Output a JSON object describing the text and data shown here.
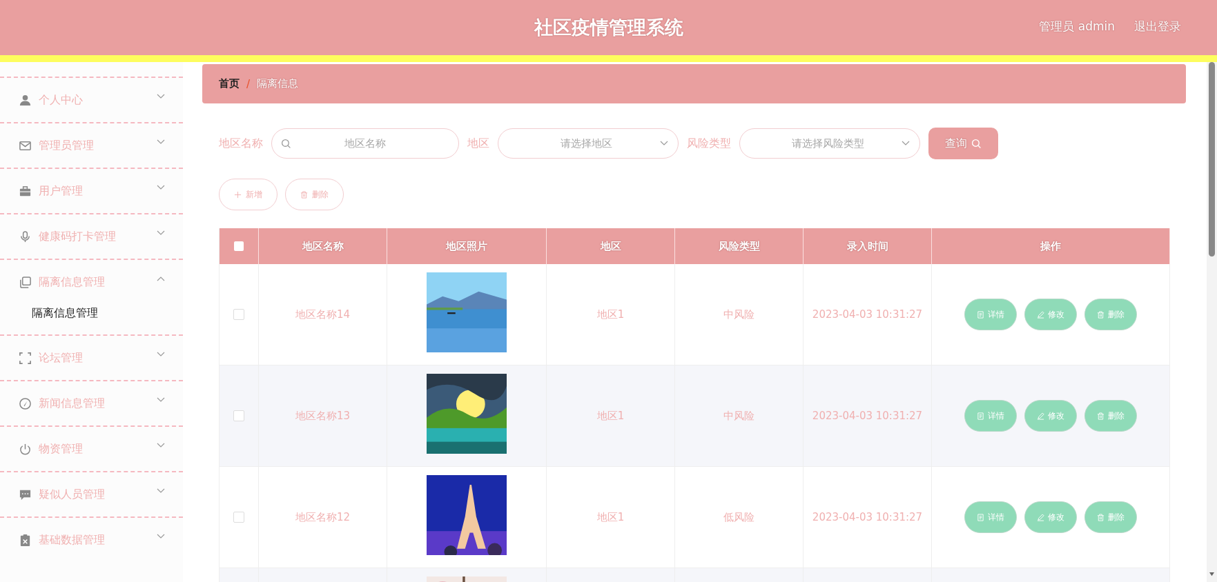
{
  "header": {
    "title": "社区疫情管理系统",
    "user": "管理员 admin",
    "logout": "退出登录"
  },
  "sidebar": {
    "items": [
      {
        "label": "个人中心",
        "expanded": false
      },
      {
        "label": "管理员管理",
        "expanded": false
      },
      {
        "label": "用户管理",
        "expanded": false
      },
      {
        "label": "健康码打卡管理",
        "expanded": false
      },
      {
        "label": "隔离信息管理",
        "expanded": true,
        "children": [
          {
            "label": "隔离信息管理",
            "selected": true
          }
        ]
      },
      {
        "label": "论坛管理",
        "expanded": false
      },
      {
        "label": "新闻信息管理",
        "expanded": false
      },
      {
        "label": "物资管理",
        "expanded": false
      },
      {
        "label": "疑似人员管理",
        "expanded": false
      },
      {
        "label": "基础数据管理",
        "expanded": false
      }
    ]
  },
  "breadcrumb": [
    "首页",
    "/",
    "隔离信息"
  ],
  "search": {
    "fields": [
      {
        "kind": "input",
        "label": "地区名称",
        "placeholder": "地区名称"
      },
      {
        "kind": "select",
        "label": "地区",
        "placeholder": "请选择地区"
      },
      {
        "kind": "select",
        "label": "风险类型",
        "placeholder": "请选择风险类型"
      }
    ],
    "button": "查询"
  },
  "actions": [
    {
      "kind": "add",
      "label": "新增"
    },
    {
      "kind": "delete",
      "label": "删除"
    }
  ],
  "table": {
    "select_all": {
      "checked": false
    },
    "columns": [
      "地区名称",
      "地区照片",
      "地区",
      "风险类型",
      "录入时间",
      "操作"
    ],
    "rows": [
      {
        "selected": false,
        "name": "地区名称14",
        "photo": {
          "kind": "picture"
        },
        "region": "地区1",
        "risk": "中风险",
        "time": "2023-04-03 10:31:27",
        "buttons": [
          {
            "kind": "detail",
            "label": "详情"
          },
          {
            "kind": "edit",
            "label": "修改"
          },
          {
            "kind": "delete",
            "label": "删除"
          }
        ]
      },
      {
        "selected": false,
        "name": "地区名称13",
        "photo": {
          "kind": "picture"
        },
        "region": "地区1",
        "risk": "中风险",
        "time": "2023-04-03 10:31:27",
        "buttons": [
          {
            "kind": "detail",
            "label": "详情"
          },
          {
            "kind": "edit",
            "label": "修改"
          },
          {
            "kind": "delete",
            "label": "删除"
          }
        ]
      },
      {
        "selected": false,
        "name": "地区名称12",
        "photo": {
          "kind": "picture"
        },
        "region": "地区1",
        "risk": "低风险",
        "time": "2023-04-03 10:31:27",
        "buttons": [
          {
            "kind": "detail",
            "label": "详情"
          },
          {
            "kind": "edit",
            "label": "修改"
          },
          {
            "kind": "delete",
            "label": "删除"
          }
        ]
      },
      {
        "photo": {
          "kind": "picture"
        }
      }
    ]
  }
}
